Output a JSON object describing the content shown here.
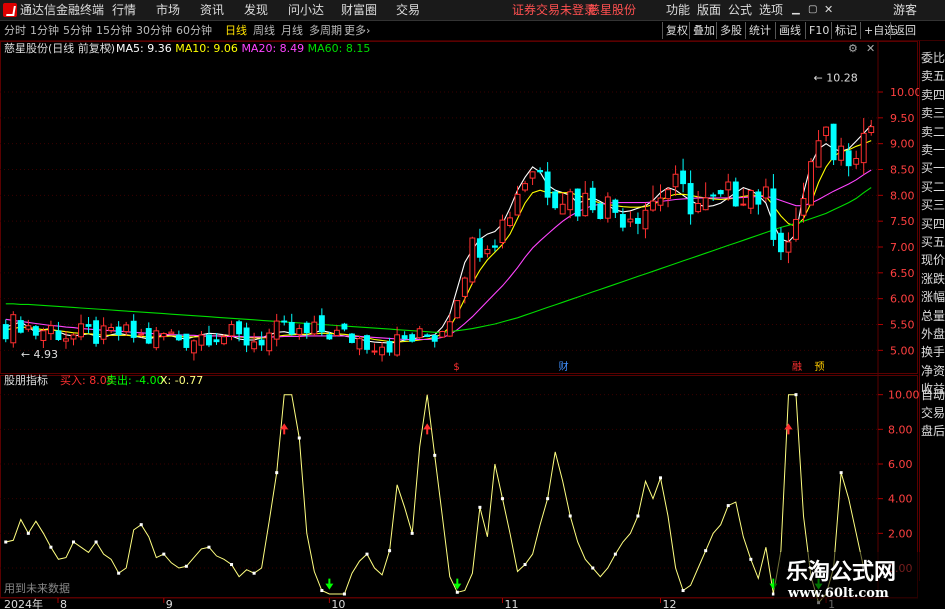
{
  "titlebar": {
    "app_title": "通达信金融终端",
    "menu": [
      "行情",
      "市场",
      "资讯",
      "发现",
      "问小达",
      "财富圈",
      "交易"
    ],
    "status_text": "证券交易未登录",
    "stock_name": "慈星股份",
    "right_menu": [
      "功能",
      "版面",
      "公式",
      "选项"
    ],
    "user": "游客"
  },
  "toolbar": {
    "periods": [
      "分时",
      "1分钟",
      "5分钟",
      "15分钟",
      "30分钟",
      "60分钟",
      "日线",
      "周线",
      "月线",
      "多周期",
      "更多"
    ],
    "active_period": "日线",
    "right_buttons": [
      "复权",
      "叠加",
      "多股",
      "统计",
      "画线",
      "F10",
      "标记",
      "+自选",
      "返回"
    ]
  },
  "main_chart": {
    "title": "慈星股份(日线 前复权)",
    "ma_labels": [
      {
        "text": "MA5: 9.36",
        "color": "#ffffff"
      },
      {
        "text": "MA10: 9.06",
        "color": "#ffff00"
      },
      {
        "text": "MA20: 8.49",
        "color": "#ff44ff"
      },
      {
        "text": "MA60: 8.15",
        "color": "#00dd00"
      }
    ],
    "high_label": "10.28",
    "low_label": "4.93",
    "markers": [
      "$",
      "财",
      "融",
      "预"
    ]
  },
  "sub_chart": {
    "title": "股朋指标",
    "buy_text": "买入: 8.05",
    "sell_text": "卖出: -4.00",
    "x_text": "X: -0.77",
    "note": "用到未来数据"
  },
  "date_axis": {
    "year_label": "2024年",
    "months": [
      "8",
      "9",
      "10",
      "11",
      "12",
      "1"
    ]
  },
  "right_panel": [
    "委比",
    "卖五",
    "卖四",
    "卖三",
    "卖二",
    "卖一",
    "买一",
    "买二",
    "买三",
    "买四",
    "买五",
    "现价",
    "涨跌",
    "涨幅",
    "总量",
    "外盘",
    "换手",
    "净资",
    "收益",
    "自动",
    "交易",
    "盘后"
  ],
  "watermark": {
    "line1": "乐淘公式网",
    "line2": "www.60lt.com"
  },
  "colors": {
    "up": "#ff3030",
    "down": "#00ffff",
    "grid": "#5a0000",
    "ma60": "#00dd00"
  },
  "chart_data": [
    {
      "type": "candlestick",
      "title": "慈星股份(日线 前复权)",
      "ylim": [
        4.6,
        10.6
      ],
      "y_ticks": [
        5.0,
        5.5,
        6.0,
        6.5,
        7.0,
        7.5,
        8.0,
        8.5,
        9.0,
        9.5,
        10.0
      ],
      "series": [
        {
          "name": "MA5",
          "values": [
            5.45,
            5.5,
            5.55,
            5.45,
            5.35,
            5.4,
            5.42,
            5.36,
            5.3,
            5.28,
            5.3,
            5.32,
            5.28,
            5.25,
            5.3,
            5.33,
            5.3,
            5.28,
            5.25,
            5.22,
            5.26,
            5.3,
            5.28,
            5.24,
            5.22,
            5.26,
            5.3,
            5.33,
            5.32,
            5.3,
            5.28,
            5.22,
            5.2,
            5.2,
            5.24,
            5.3,
            5.35,
            5.36,
            5.33,
            5.3,
            5.3,
            5.35,
            5.38,
            5.35,
            5.3,
            5.28,
            5.25,
            5.22,
            5.18,
            5.16,
            5.15,
            5.14,
            5.16,
            5.2,
            5.22,
            5.25,
            5.28,
            5.3,
            5.45,
            5.7,
            6.2,
            6.7,
            6.95,
            7.15,
            7.25,
            7.3,
            7.45,
            7.75,
            8.1,
            8.35,
            8.55,
            8.45,
            8.2,
            8.1,
            8.05,
            8.0,
            7.85,
            7.9,
            7.95,
            7.88,
            7.8,
            7.72,
            7.68,
            7.7,
            7.75,
            7.8,
            7.9,
            8.05,
            8.15,
            8.1,
            8.0,
            7.9,
            7.82,
            7.78,
            7.8,
            7.85,
            7.95,
            8.05,
            8.15,
            8.1,
            8.0,
            7.85,
            7.45,
            7.15,
            7.1,
            7.25,
            8.05,
            8.6,
            8.9,
            9.0,
            8.9,
            8.85,
            8.9,
            9.05,
            9.2,
            9.36
          ]
        },
        {
          "name": "MA10",
          "values": [
            5.4,
            5.42,
            5.45,
            5.44,
            5.42,
            5.4,
            5.4,
            5.38,
            5.36,
            5.34,
            5.33,
            5.32,
            5.31,
            5.29,
            5.29,
            5.29,
            5.29,
            5.28,
            5.27,
            5.26,
            5.26,
            5.27,
            5.28,
            5.27,
            5.26,
            5.26,
            5.27,
            5.28,
            5.28,
            5.28,
            5.28,
            5.26,
            5.25,
            5.24,
            5.24,
            5.25,
            5.27,
            5.29,
            5.3,
            5.31,
            5.31,
            5.32,
            5.33,
            5.33,
            5.32,
            5.31,
            5.29,
            5.27,
            5.24,
            5.21,
            5.19,
            5.17,
            5.16,
            5.17,
            5.18,
            5.2,
            5.22,
            5.25,
            5.32,
            5.45,
            5.7,
            6.0,
            6.3,
            6.55,
            6.75,
            6.9,
            7.05,
            7.25,
            7.55,
            7.85,
            8.05,
            8.1,
            8.05,
            8.05,
            8.05,
            8.05,
            8.0,
            7.95,
            7.9,
            7.85,
            7.82,
            7.8,
            7.78,
            7.77,
            7.77,
            7.78,
            7.82,
            7.9,
            7.98,
            8.02,
            8.02,
            8.0,
            7.97,
            7.95,
            7.93,
            7.92,
            7.93,
            7.95,
            7.98,
            8.0,
            8.0,
            7.98,
            7.8,
            7.6,
            7.45,
            7.4,
            7.55,
            7.85,
            8.25,
            8.55,
            8.75,
            8.85,
            8.88,
            8.95,
            9.0,
            9.06
          ]
        },
        {
          "name": "MA20",
          "values": [
            5.6,
            5.58,
            5.56,
            5.54,
            5.52,
            5.5,
            5.48,
            5.47,
            5.45,
            5.44,
            5.42,
            5.41,
            5.4,
            5.39,
            5.38,
            5.37,
            5.36,
            5.35,
            5.34,
            5.33,
            5.32,
            5.31,
            5.3,
            5.3,
            5.29,
            5.29,
            5.28,
            5.28,
            5.28,
            5.27,
            5.27,
            5.27,
            5.26,
            5.26,
            5.26,
            5.26,
            5.26,
            5.27,
            5.27,
            5.27,
            5.28,
            5.28,
            5.28,
            5.28,
            5.28,
            5.28,
            5.27,
            5.27,
            5.26,
            5.25,
            5.24,
            5.23,
            5.22,
            5.21,
            5.21,
            5.21,
            5.21,
            5.22,
            5.25,
            5.3,
            5.4,
            5.52,
            5.65,
            5.8,
            5.95,
            6.1,
            6.25,
            6.42,
            6.6,
            6.8,
            6.98,
            7.12,
            7.25,
            7.38,
            7.5,
            7.6,
            7.68,
            7.75,
            7.8,
            7.83,
            7.85,
            7.86,
            7.86,
            7.86,
            7.86,
            7.86,
            7.87,
            7.88,
            7.9,
            7.92,
            7.93,
            7.94,
            7.95,
            7.95,
            7.95,
            7.95,
            7.95,
            7.95,
            7.96,
            7.97,
            7.98,
            7.98,
            7.95,
            7.9,
            7.85,
            7.8,
            7.8,
            7.85,
            7.92,
            8.0,
            8.08,
            8.15,
            8.22,
            8.3,
            8.4,
            8.49
          ]
        },
        {
          "name": "MA60",
          "values": [
            5.9,
            5.9,
            5.89,
            5.89,
            5.88,
            5.87,
            5.86,
            5.85,
            5.84,
            5.83,
            5.82,
            5.81,
            5.8,
            5.79,
            5.78,
            5.77,
            5.76,
            5.75,
            5.74,
            5.73,
            5.72,
            5.71,
            5.7,
            5.69,
            5.68,
            5.67,
            5.66,
            5.65,
            5.64,
            5.63,
            5.62,
            5.61,
            5.6,
            5.59,
            5.58,
            5.57,
            5.56,
            5.55,
            5.54,
            5.53,
            5.52,
            5.51,
            5.5,
            5.49,
            5.48,
            5.47,
            5.46,
            5.45,
            5.44,
            5.43,
            5.42,
            5.41,
            5.4,
            5.39,
            5.38,
            5.37,
            5.36,
            5.35,
            5.35,
            5.36,
            5.38,
            5.4,
            5.42,
            5.45,
            5.48,
            5.51,
            5.55,
            5.59,
            5.63,
            5.68,
            5.73,
            5.78,
            5.83,
            5.88,
            5.93,
            5.98,
            6.03,
            6.08,
            6.13,
            6.18,
            6.23,
            6.28,
            6.33,
            6.38,
            6.43,
            6.48,
            6.53,
            6.58,
            6.63,
            6.68,
            6.73,
            6.78,
            6.83,
            6.88,
            6.93,
            6.98,
            7.03,
            7.08,
            7.13,
            7.18,
            7.23,
            7.28,
            7.33,
            7.38,
            7.42,
            7.46,
            7.5,
            7.55,
            7.6,
            7.65,
            7.72,
            7.79,
            7.86,
            7.94,
            8.05,
            8.15
          ]
        }
      ]
    },
    {
      "type": "line",
      "title": "股朋指标",
      "ylim": [
        -1.5,
        10.5
      ],
      "y_ticks": [
        0.0,
        2.0,
        4.0,
        6.0,
        8.0,
        10.0
      ],
      "series": [
        {
          "name": "X",
          "values": [
            1.5,
            1.6,
            2.8,
            2.0,
            2.7,
            2.0,
            1.2,
            0.5,
            0.6,
            1.5,
            1.2,
            0.9,
            1.5,
            0.8,
            0.5,
            -0.3,
            0.0,
            2.2,
            2.5,
            1.8,
            0.6,
            0.8,
            0.3,
            0.0,
            0.1,
            0.6,
            1.1,
            1.2,
            0.7,
            0.5,
            0.2,
            -0.5,
            -0.1,
            -0.3,
            0.0,
            2.7,
            5.5,
            10.0,
            10.0,
            7.5,
            2.0,
            -0.2,
            -1.3,
            -1.5,
            -1.5,
            -1.5,
            -0.3,
            0.4,
            0.8,
            0.0,
            -0.4,
            1.0,
            4.8,
            3.5,
            2.0,
            7.0,
            10.0,
            6.5,
            3.0,
            -0.5,
            -1.4,
            -1.3,
            -0.3,
            3.5,
            1.8,
            6.0,
            4.0,
            2.0,
            -0.2,
            0.2,
            0.8,
            2.5,
            4.0,
            6.7,
            5.0,
            3.0,
            1.5,
            0.5,
            0.0,
            -0.5,
            0.0,
            0.8,
            1.5,
            2.0,
            3.0,
            5.0,
            4.0,
            5.2,
            3.0,
            0.0,
            -1.3,
            -1.0,
            0.0,
            1.0,
            2.0,
            2.5,
            3.6,
            3.8,
            1.8,
            0.5,
            -0.6,
            1.2,
            -1.5,
            1.0,
            10.0,
            10.0,
            3.0,
            -0.5,
            -2.0,
            -1.5,
            0.0,
            5.5,
            4.0,
            2.0,
            0.0,
            -0.77
          ]
        }
      ]
    }
  ]
}
